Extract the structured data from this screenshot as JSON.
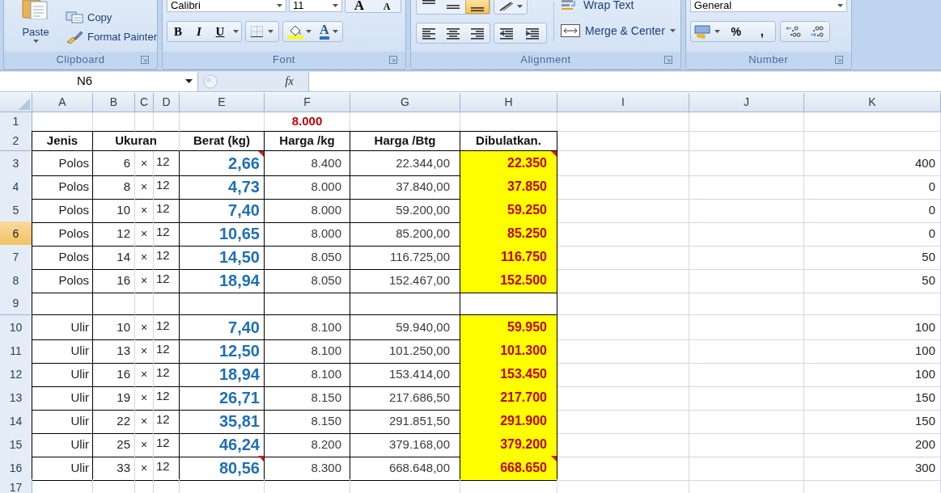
{
  "ribbon": {
    "clipboard": {
      "label": "Clipboard",
      "paste": "Paste",
      "copy": "Copy",
      "format_painter": "Format Painter"
    },
    "font": {
      "label": "Font",
      "font_name": "Calibri",
      "font_size": "11",
      "grow": "A",
      "shrink": "A",
      "bold": "B",
      "italic": "I",
      "underline": "U",
      "font_color": "A"
    },
    "alignment": {
      "label": "Alignment",
      "vertical_align": [
        {
          "selected": false
        },
        {
          "selected": false
        },
        {
          "selected": true
        }
      ],
      "wrap_text": "Wrap Text",
      "merge_center": "Merge & Center"
    },
    "number": {
      "label": "Number",
      "format": "General",
      "percent": "%",
      "comma": ","
    }
  },
  "formula_bar": {
    "name_box": "N6",
    "fx": "fx"
  },
  "columns": [
    "A",
    "B",
    "C",
    "D",
    "E",
    "F",
    "G",
    "H",
    "I",
    "J",
    "K"
  ],
  "rows": [
    {
      "number": "1",
      "kind": "note",
      "selected": false,
      "f": "8.000"
    },
    {
      "number": "2",
      "kind": "header",
      "selected": false,
      "a": "Jenis",
      "b": "Ukuran",
      "e": "**Berat** (kg)",
      "f": "Harga /kg",
      "g": "Harga /Btg",
      "h": "Dibulatkan."
    },
    {
      "number": "3",
      "kind": "item",
      "selected": false,
      "a": "Polos",
      "b": "6",
      "c": "×",
      "d": "12",
      "e": "2,66",
      "f": "8.400",
      "g": "22.344,00",
      "h": "22.350",
      "k": "400",
      "e_comment": true,
      "h_comment": true
    },
    {
      "number": "4",
      "kind": "item",
      "selected": false,
      "a": "Polos",
      "b": "8",
      "c": "×",
      "d": "12",
      "e": "4,73",
      "f": "8.000",
      "g": "37.840,00",
      "h": "37.850",
      "k": "0",
      "e_comment": false,
      "h_comment": false
    },
    {
      "number": "5",
      "kind": "item",
      "selected": false,
      "a": "Polos",
      "b": "10",
      "c": "×",
      "d": "12",
      "e": "7,40",
      "f": "8.000",
      "g": "59.200,00",
      "h": "59.250",
      "k": "0",
      "e_comment": false,
      "h_comment": false
    },
    {
      "number": "6",
      "kind": "item",
      "selected": true,
      "a": "Polos",
      "b": "12",
      "c": "×",
      "d": "12",
      "e": "10,65",
      "f": "8.000",
      "g": "85.200,00",
      "h": "85.250",
      "k": "0",
      "e_comment": false,
      "h_comment": false
    },
    {
      "number": "7",
      "kind": "item",
      "selected": false,
      "a": "Polos",
      "b": "14",
      "c": "×",
      "d": "12",
      "e": "14,50",
      "f": "8.050",
      "g": "116.725,00",
      "h": "116.750",
      "k": "50",
      "e_comment": false,
      "h_comment": false
    },
    {
      "number": "8",
      "kind": "item",
      "selected": false,
      "a": "Polos",
      "b": "16",
      "c": "×",
      "d": "12",
      "e": "18,94",
      "f": "8.050",
      "g": "152.467,00",
      "h": "152.500",
      "k": "50",
      "e_comment": false,
      "h_comment": false
    },
    {
      "number": "9",
      "kind": "blank",
      "selected": false
    },
    {
      "number": "10",
      "kind": "item",
      "selected": false,
      "a": "Ulir",
      "b": "10",
      "c": "×",
      "d": "12",
      "e": "7,40",
      "f": "8.100",
      "g": "59.940,00",
      "h": "59.950",
      "k": "100",
      "e_comment": false,
      "h_comment": false
    },
    {
      "number": "11",
      "kind": "item",
      "selected": false,
      "a": "Ulir",
      "b": "13",
      "c": "×",
      "d": "12",
      "e": "12,50",
      "f": "8.100",
      "g": "101.250,00",
      "h": "101.300",
      "k": "100",
      "e_comment": false,
      "h_comment": false
    },
    {
      "number": "12",
      "kind": "item",
      "selected": false,
      "a": "Ulir",
      "b": "16",
      "c": "×",
      "d": "12",
      "e": "18,94",
      "f": "8.100",
      "g": "153.414,00",
      "h": "153.450",
      "k": "100",
      "e_comment": false,
      "h_comment": false
    },
    {
      "number": "13",
      "kind": "item",
      "selected": false,
      "a": "Ulir",
      "b": "19",
      "c": "×",
      "d": "12",
      "e": "26,71",
      "f": "8.150",
      "g": "217.686,50",
      "h": "217.700",
      "k": "150",
      "e_comment": false,
      "h_comment": false
    },
    {
      "number": "14",
      "kind": "item",
      "selected": false,
      "a": "Ulir",
      "b": "22",
      "c": "×",
      "d": "12",
      "e": "35,81",
      "f": "8.150",
      "g": "291.851,50",
      "h": "291.900",
      "k": "150",
      "e_comment": false,
      "h_comment": false
    },
    {
      "number": "15",
      "kind": "item",
      "selected": false,
      "a": "Ulir",
      "b": "25",
      "c": "×",
      "d": "12",
      "e": "46,24",
      "f": "8.200",
      "g": "379.168,00",
      "h": "379.200",
      "k": "200",
      "e_comment": false,
      "h_comment": false
    },
    {
      "number": "16",
      "kind": "item",
      "selected": false,
      "a": "Ulir",
      "b": "33",
      "c": "×",
      "d": "12",
      "e": "80,56",
      "f": "8.300",
      "g": "668.648,00",
      "h": "668.650",
      "k": "300",
      "e_comment": true,
      "h_comment": true
    },
    {
      "number": "17",
      "kind": "tail",
      "selected": false
    }
  ]
}
